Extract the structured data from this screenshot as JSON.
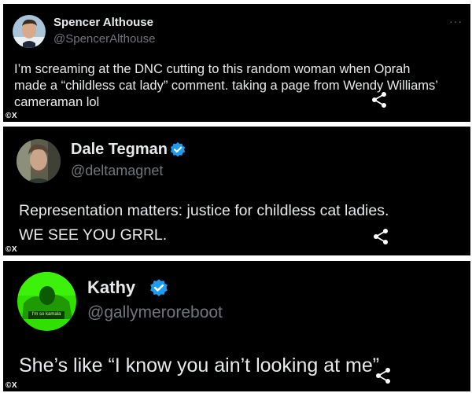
{
  "posts": [
    {
      "name": "Spencer Althouse",
      "handle": "@SpencerAlthouse",
      "text": "I’m screaming at the DNC cutting to this random woman when Oprah made a “childless cat lady” comment. taking a page from Wendy Williams’ cameraman lol",
      "verified": false,
      "more_icon": "···"
    },
    {
      "name": "Dale Tegman",
      "handle": "@deltamagnet",
      "line1": "Representation matters: justice for childless cat ladies.",
      "line2": "WE SEE YOU GRRL.",
      "verified": true
    },
    {
      "name": "Kathy",
      "handle": "@gallymeroreboot",
      "text": "She’s like “I know you ain’t looking at me”",
      "verified": true,
      "avatar_caption": "I'm so kamala"
    }
  ],
  "watermark": "©X",
  "icons": {
    "share": "share-icon",
    "verified": "verified-badge-icon",
    "more": "more-icon"
  },
  "colors": {
    "card_bg": "#000000",
    "text": "#e7e9ea",
    "handle": "#71767b",
    "verified": "#1d9bf0",
    "avatar3_green": "#2fe000"
  }
}
